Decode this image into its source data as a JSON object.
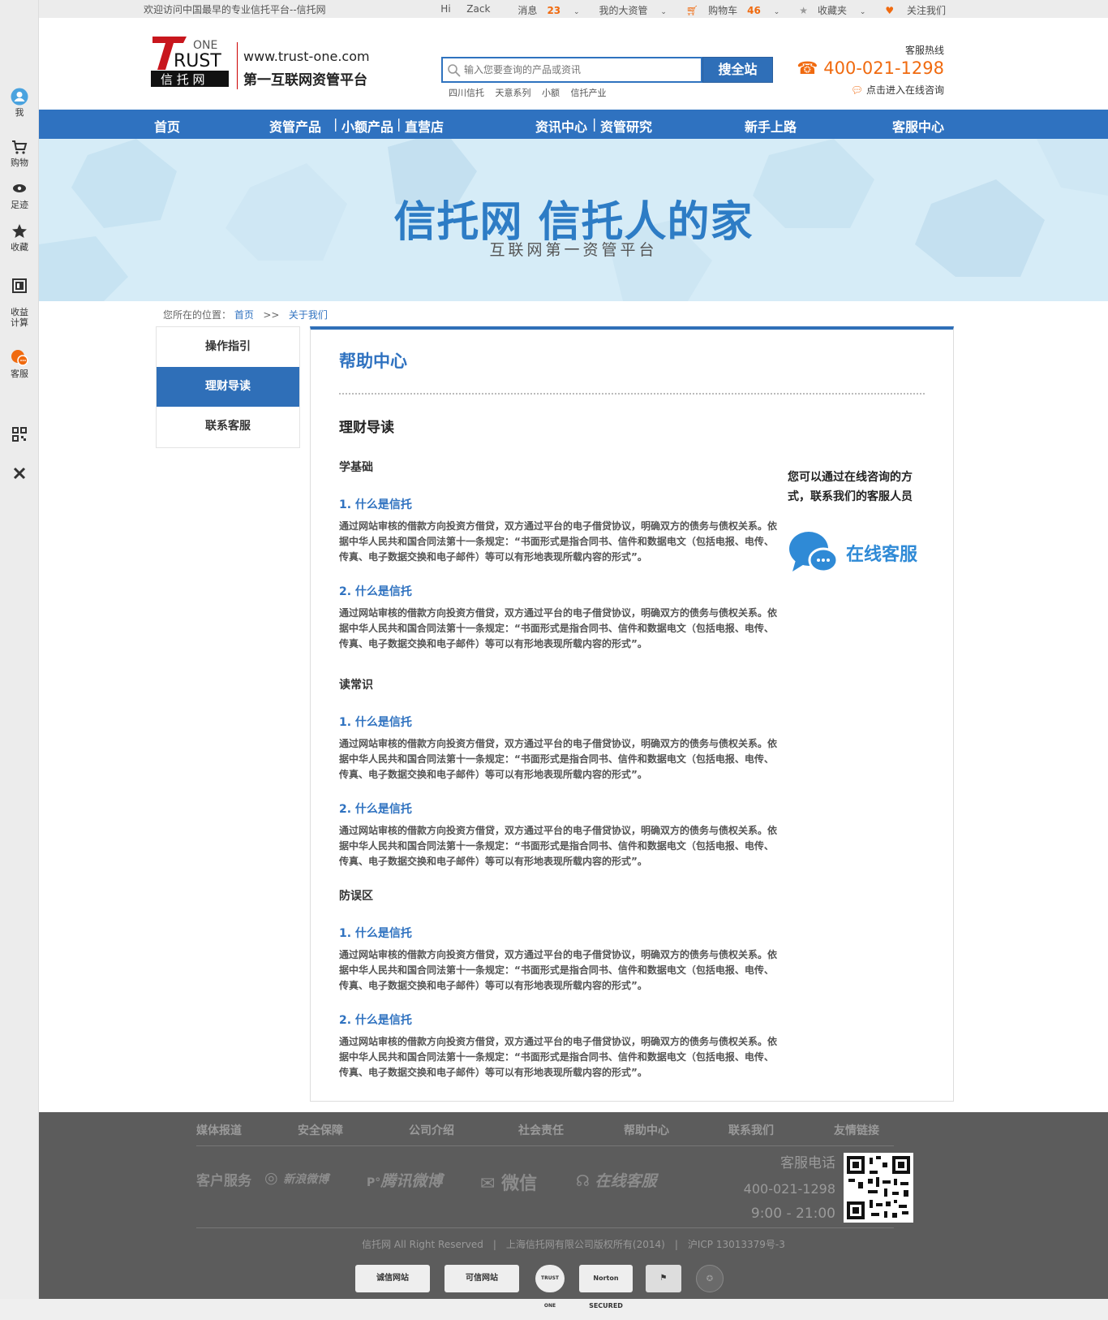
{
  "sidebar": {
    "items": [
      {
        "label": "我",
        "icon": "user-icon"
      },
      {
        "label": "购物",
        "icon": "cart-icon"
      },
      {
        "label": "足迹",
        "icon": "eye-icon"
      },
      {
        "label": "收藏",
        "icon": "star-icon"
      },
      {
        "label": "收益\n计算",
        "icon": "calculator-icon"
      },
      {
        "label": "客服",
        "icon": "chat-icon"
      },
      {
        "label": "",
        "icon": "qrcode-icon"
      },
      {
        "label": "",
        "icon": "close-icon"
      }
    ]
  },
  "topbar": {
    "welcome": "欢迎访问中国最早的专业信托平台--信托网",
    "greeting": "Hi",
    "username": "Zack",
    "messages_label": "消息",
    "messages_count": "23",
    "my_assets": "我的大资管",
    "cart_label": "购物车",
    "cart_count": "46",
    "favorites": "收藏夹",
    "follow": "关注我们"
  },
  "header": {
    "logo_one": "ONE",
    "logo_rust": "RUST",
    "logo_cn": "信 托 网",
    "site_url": "www.trust-one.com",
    "slogan": "第一互联网资管平台",
    "search_placeholder": "输入您要查询的产品或资讯",
    "search_button": "搜全站",
    "hot_tags": [
      "四川信托",
      "天意系列",
      "小额",
      "信托产业"
    ],
    "hotline_label": "客服热线",
    "hotline_number": "400-021-1298",
    "online_consult": "点击进入在线咨询"
  },
  "nav": {
    "home": "首页",
    "asset_products": "资管产品",
    "small_products": "小额产品",
    "direct_store": "直营店",
    "news_center": "资讯中心",
    "research": "资管研究",
    "newbie": "新手上路",
    "service_center": "客服中心",
    "sep": "|"
  },
  "banner": {
    "title": "信托网 信托人的家",
    "subtitle": "互联网第一资管平台"
  },
  "breadcrumb": {
    "prefix": "您所在的位置：",
    "home": "首页",
    "sep": ">>",
    "current": "关于我们"
  },
  "left_menu": {
    "items": [
      "操作指引",
      "理财导读",
      "联系客服"
    ],
    "active_index": 1
  },
  "content": {
    "title": "帮助中心",
    "article_title": "理财导读",
    "sections": [
      {
        "heading": "学基础",
        "qas": [
          {
            "q": "1. 什么是信托",
            "a": "通过网站审核的借款方向投资方借贷，双方通过平台的电子借贷协议，明确双方的债务与债权关系。依据中华人民共和国合同法第十一条规定：“书面形式是指合同书、信件和数据电文（包括电报、电传、传真、电子数据交换和电子邮件）等可以有形地表现所载内容的形式”。"
          },
          {
            "q": "2. 什么是信托",
            "a": "通过网站审核的借款方向投资方借贷，双方通过平台的电子借贷协议，明确双方的债务与债权关系。依据中华人民共和国合同法第十一条规定：“书面形式是指合同书、信件和数据电文（包括电报、电传、传真、电子数据交换和电子邮件）等可以有形地表现所载内容的形式”。"
          }
        ]
      },
      {
        "heading": "读常识",
        "qas": [
          {
            "q": "1. 什么是信托",
            "a": "通过网站审核的借款方向投资方借贷，双方通过平台的电子借贷协议，明确双方的债务与债权关系。依据中华人民共和国合同法第十一条规定：“书面形式是指合同书、信件和数据电文（包括电报、电传、传真、电子数据交换和电子邮件）等可以有形地表现所载内容的形式”。"
          },
          {
            "q": "2. 什么是信托",
            "a": "通过网站审核的借款方向投资方借贷，双方通过平台的电子借贷协议，明确双方的债务与债权关系。依据中华人民共和国合同法第十一条规定：“书面形式是指合同书、信件和数据电文（包括电报、电传、传真、电子数据交换和电子邮件）等可以有形地表现所载内容的形式”。"
          }
        ]
      },
      {
        "heading": "防误区",
        "qas": [
          {
            "q": "1. 什么是信托",
            "a": "通过网站审核的借款方向投资方借贷，双方通过平台的电子借贷协议，明确双方的债务与债权关系。依据中华人民共和国合同法第十一条规定：“书面形式是指合同书、信件和数据电文（包括电报、电传、传真、电子数据交换和电子邮件）等可以有形地表现所载内容的形式”。"
          },
          {
            "q": "2. 什么是信托",
            "a": "通过网站审核的借款方向投资方借贷，双方通过平台的电子借贷协议，明确双方的债务与债权关系。依据中华人民共和国合同法第十一条规定：“书面形式是指合同书、信件和数据电文（包括电报、电传、传真、电子数据交换和电子邮件）等可以有形地表现所载内容的形式”。"
          }
        ]
      }
    ],
    "side_help_text": "您可以通过在线咨询的方式，联系我们的客服人员",
    "side_kefu_label": "在线客服"
  },
  "footer": {
    "links": [
      "媒体报道",
      "安全保障",
      "公司介绍",
      "社会责任",
      "帮助中心",
      "联系我们",
      "友情链接"
    ],
    "customer_service": "客户服务",
    "sina_weibo": "新浪微博",
    "tencent_weibo": "腾讯微博",
    "wechat": "微信",
    "online_service": "在线客服",
    "phone_label": "客服电话",
    "phone": "400-021-1298",
    "hours": "9:00 - 21:00",
    "copyright": "信托网 All Right Reserved　|　上海信托网有限公司版权所有(2014)　|　沪ICP 13013379号-3",
    "badges": [
      "诚信网站",
      "可信网站",
      "TRUST ONE",
      "Norton SECURED",
      "",
      ""
    ]
  },
  "colors": {
    "brand_blue": "#2f72c0",
    "accent_orange": "#f06a0f",
    "footer_bg": "#5c5c5c"
  }
}
